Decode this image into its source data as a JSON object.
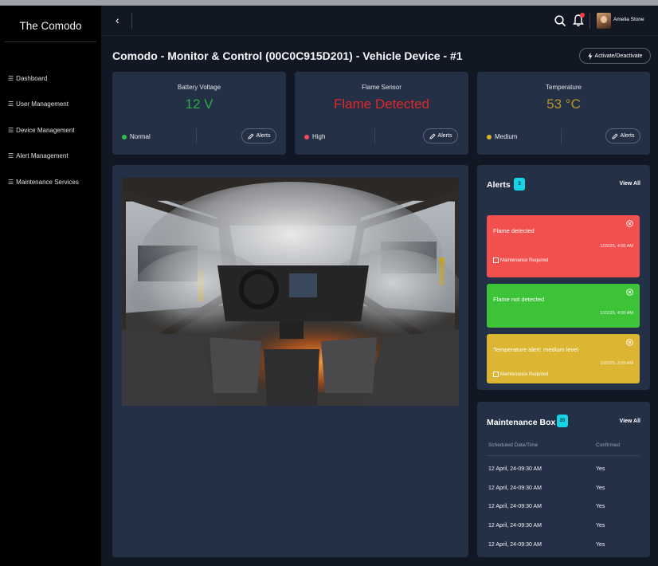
{
  "sidebar": {
    "brand": "The Comodo",
    "items": [
      {
        "icon": "list-icon",
        "label": "Dashboard"
      },
      {
        "icon": "list-icon",
        "label": "User Management"
      },
      {
        "icon": "list-icon",
        "label": "Device Management"
      },
      {
        "icon": "list-icon",
        "label": "Alert Management"
      },
      {
        "icon": "list-icon",
        "label": "Maintenance Services"
      }
    ]
  },
  "topbar": {
    "back_icon": "chevron-left-icon",
    "search_icon": "search-icon",
    "bell_icon": "bell-icon",
    "user_name": "Amelia Stone"
  },
  "page": {
    "title": "Comodo - Monitor & Control (00C0C915D201) - Vehicle Device - #1",
    "action_label": "Activate/Deactivate"
  },
  "stats": [
    {
      "title": "Battery Voltage",
      "value": "12 V",
      "value_color": "#2fa84a",
      "status": "Normal",
      "status_color": "#2fbf4a",
      "button": "Alerts"
    },
    {
      "title": "Flame Sensor",
      "value": "Flame Detected",
      "value_color": "#e02828",
      "status": "High",
      "status_color": "#ef4b5a",
      "button": "Alerts"
    },
    {
      "title": "Temperature",
      "value": "53 °C",
      "value_color": "#b9942e",
      "status": "Medium",
      "status_color": "#d9b32a",
      "button": "Alerts"
    }
  ],
  "alerts": {
    "title": "Alerts",
    "count": "3",
    "view_all": "View All",
    "items": [
      {
        "text": "Flame detected",
        "time": "1/22/25, 4:00 AM",
        "maintenance": "Maintenance Required",
        "color": "#f2504f"
      },
      {
        "text": "Flame not detected",
        "time": "1/22/25, 4:00 AM",
        "maintenance": "",
        "color": "#3cc338"
      },
      {
        "text": "Temperature alert: medium level",
        "time": "1/22/25, 3:59 AM",
        "maintenance": "Maintenance Required",
        "color": "#dcb632"
      }
    ]
  },
  "maintenance": {
    "title": "Maintenance Box",
    "count": "20",
    "view_all": "View All",
    "headers": [
      "Scheduled Date/Time",
      "Confirmed"
    ],
    "rows": [
      [
        "12 April, 24-09:30 AM",
        "Yes"
      ],
      [
        "12 April, 24-09:30 AM",
        "Yes"
      ],
      [
        "12 April, 24-09:30 AM",
        "Yes"
      ],
      [
        "12 April, 24-09:30 AM",
        "Yes"
      ],
      [
        "12 April, 24-09:30 AM",
        "Yes"
      ]
    ]
  }
}
